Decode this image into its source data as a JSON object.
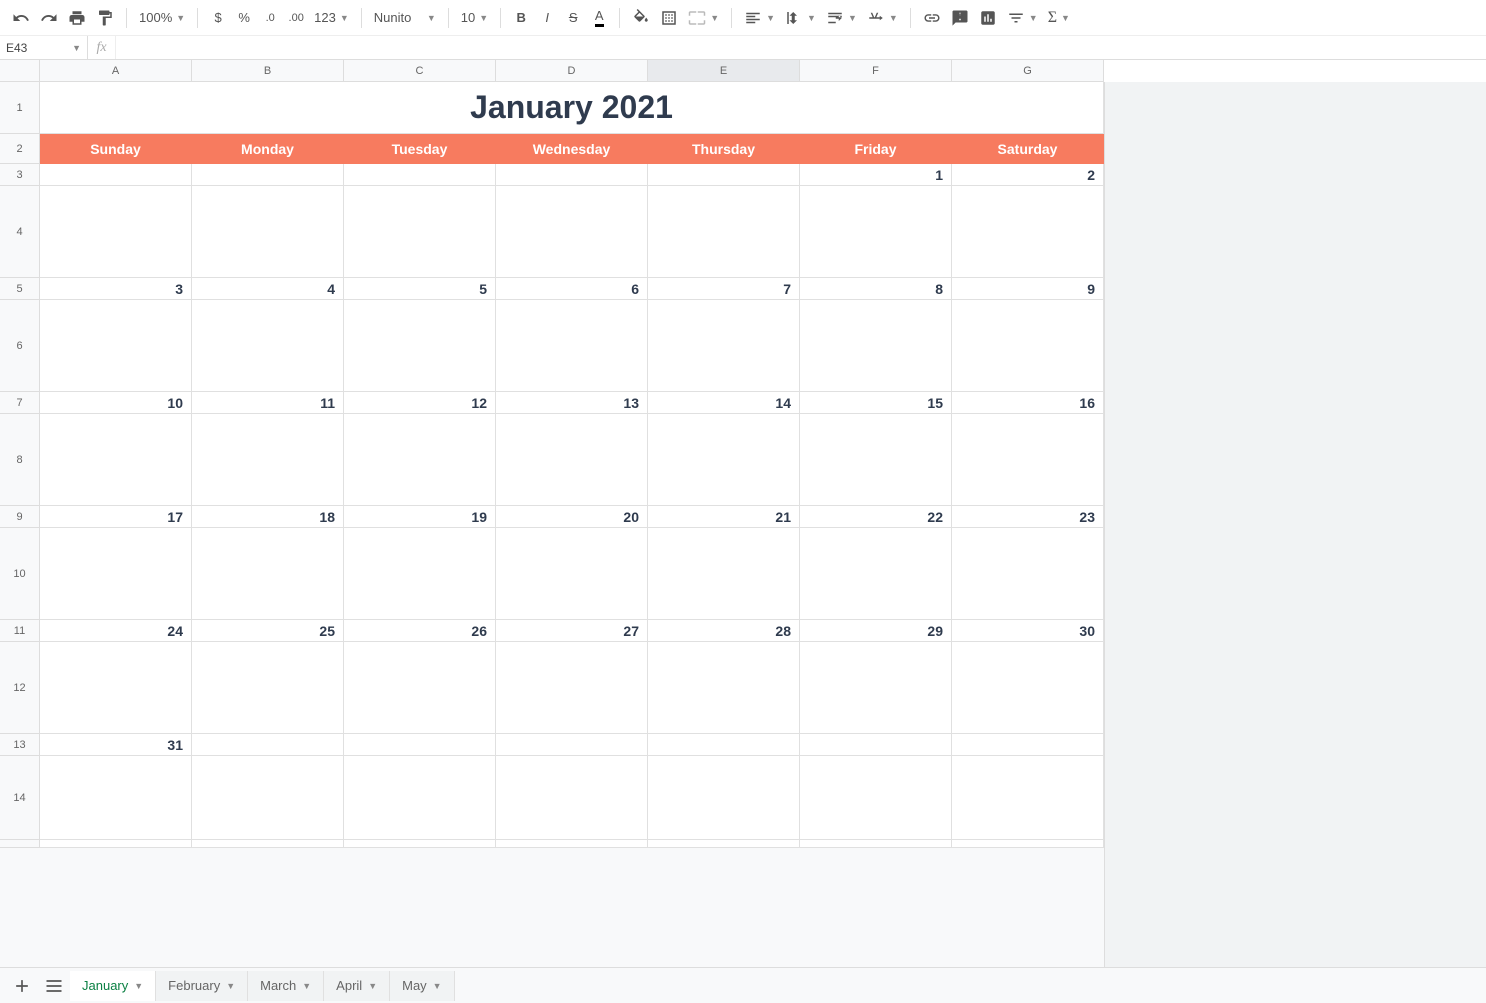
{
  "toolbar": {
    "zoom": "100%",
    "font_name": "Nunito",
    "font_size": "10",
    "more_formats": "123"
  },
  "name_box": "E43",
  "formula": "",
  "columns": [
    "A",
    "B",
    "C",
    "D",
    "E",
    "F",
    "G"
  ],
  "selected_col_index": 4,
  "rows": [
    "1",
    "2",
    "3",
    "4",
    "5",
    "6",
    "7",
    "8",
    "9",
    "10",
    "11",
    "12",
    "13",
    "14"
  ],
  "title": "January 2021",
  "day_names": [
    "Sunday",
    "Monday",
    "Tuesday",
    "Wednesday",
    "Thursday",
    "Friday",
    "Saturday"
  ],
  "weeks": [
    [
      "",
      "",
      "",
      "",
      "",
      "1",
      "2"
    ],
    [
      "3",
      "4",
      "5",
      "6",
      "7",
      "8",
      "9"
    ],
    [
      "10",
      "11",
      "12",
      "13",
      "14",
      "15",
      "16"
    ],
    [
      "17",
      "18",
      "19",
      "20",
      "21",
      "22",
      "23"
    ],
    [
      "24",
      "25",
      "26",
      "27",
      "28",
      "29",
      "30"
    ],
    [
      "31",
      "",
      "",
      "",
      "",
      "",
      ""
    ]
  ],
  "sheets": {
    "active": "January",
    "tabs": [
      "January",
      "February",
      "March",
      "April",
      "May"
    ]
  }
}
